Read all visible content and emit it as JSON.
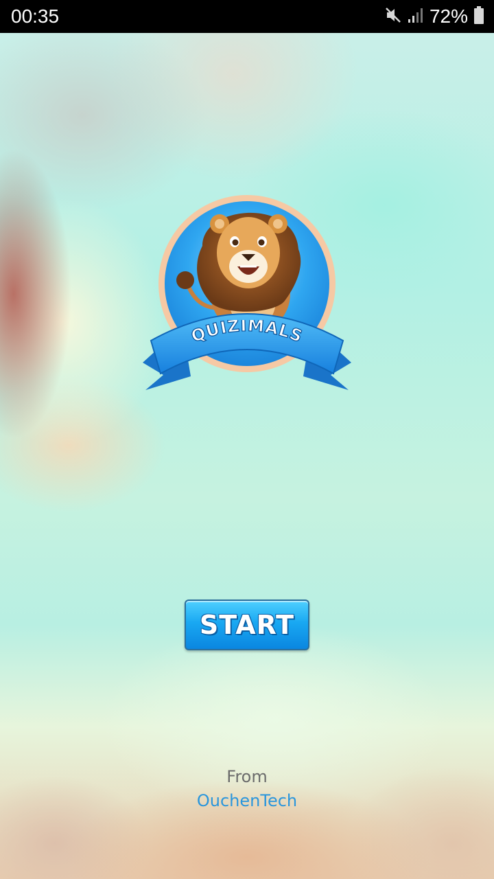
{
  "status_bar": {
    "time": "00:35",
    "battery_percent": "72%",
    "icons": [
      "mute-icon",
      "signal-icon",
      "battery-icon"
    ]
  },
  "logo": {
    "title": "QUIZIMALS",
    "mascot": "lion"
  },
  "start_button": {
    "label": "START"
  },
  "credits": {
    "from_label": "From",
    "company": "OuchenTech"
  },
  "colors": {
    "primary_blue": "#19a8f2",
    "company_text": "#2a96dc",
    "ribbon": "#1f8fe6"
  }
}
